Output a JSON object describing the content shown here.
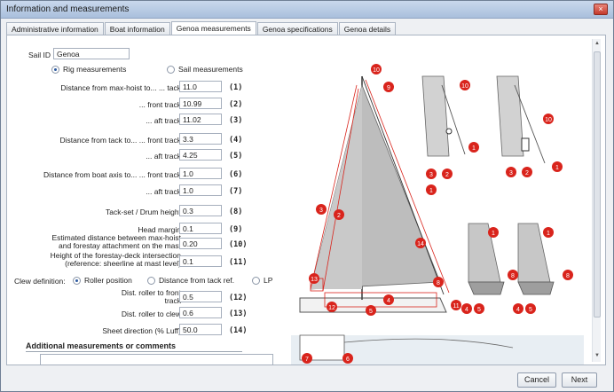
{
  "window": {
    "title": "Information and measurements",
    "close_glyph": "×"
  },
  "tabs": [
    {
      "label": "Administrative information"
    },
    {
      "label": "Boat information"
    },
    {
      "label": "Genoa measurements",
      "active": true
    },
    {
      "label": "Genoa specifications"
    },
    {
      "label": "Genoa details"
    }
  ],
  "form": {
    "sail_id_label": "Sail ID",
    "sail_id_value": "Genoa",
    "mode_rig": "Rig measurements",
    "mode_sail": "Sail measurements",
    "mode_selected": "Rig measurements",
    "rows": [
      {
        "label": "Distance from max-hoist to...         ... tack",
        "value": "11.0",
        "num": "(1)"
      },
      {
        "label": "... front track",
        "value": "10.99",
        "num": "(2)"
      },
      {
        "label": "... aft track",
        "value": "11.02",
        "num": "(3)"
      },
      {
        "label": "Distance from tack to...         ... front track",
        "value": "3.3",
        "num": "(4)"
      },
      {
        "label": "... aft track",
        "value": "4.25",
        "num": "(5)"
      },
      {
        "label": "Distance from boat axis to...   ... front track",
        "value": "1.0",
        "num": "(6)"
      },
      {
        "label": "... aft track",
        "value": "1.0",
        "num": "(7)"
      },
      {
        "label": "Tack-set / Drum height",
        "value": "0.3",
        "num": "(8)"
      },
      {
        "label": "Head margin",
        "value": "0.1",
        "num": "(9)"
      },
      {
        "label": "Estimated distance between max-hoist and forestay attachment on the mast",
        "value": "0.20",
        "num": "(10)"
      },
      {
        "label": "Height of the forestay-deck intersection (reference: sheerline at mast level)",
        "value": "0.1",
        "num": "(11)"
      }
    ],
    "clew_label": "Clew definition:",
    "clew_roller": "Roller position",
    "clew_tack": "Distance from tack ref.",
    "clew_lp": "LP",
    "clew_selected": "Roller position",
    "clew_rows": [
      {
        "label": "Dist. roller to front track",
        "value": "0.5",
        "num": "(12)"
      },
      {
        "label": "Dist. roller to clew",
        "value": "0.6",
        "num": "(13)"
      },
      {
        "label": "Sheet direction (% Luff)",
        "value": "50.0",
        "num": "(14)"
      }
    ],
    "comments_title": "Additional measurements or comments",
    "comments_value": ""
  },
  "diagram": {
    "markers": [
      "1",
      "2",
      "3",
      "4",
      "5",
      "6",
      "7",
      "8",
      "9",
      "10",
      "11",
      "12",
      "13",
      "14"
    ],
    "marker_color": "#d9241c",
    "sail_color": "#bdbdbd"
  },
  "buttons": {
    "cancel": "Cancel",
    "next": "Next"
  }
}
